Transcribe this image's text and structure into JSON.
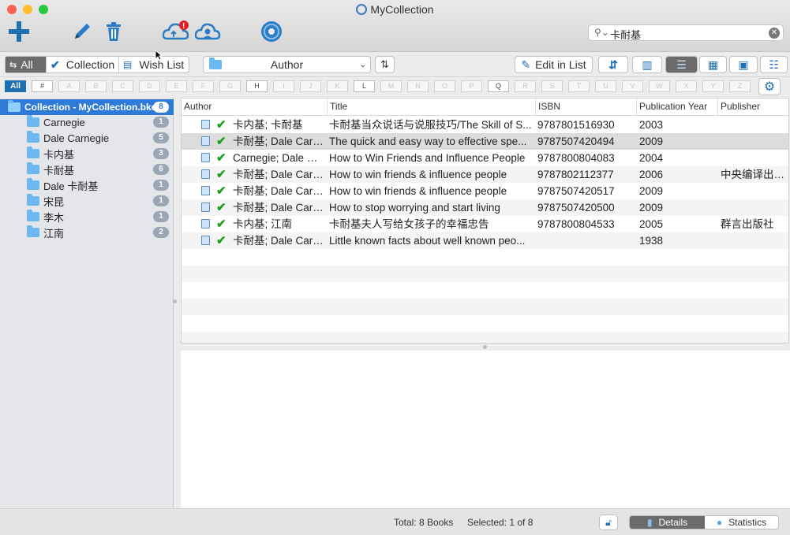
{
  "window": {
    "title": "MyCollection"
  },
  "colors": {
    "accent": "#2f7ad6",
    "check": "#1e9e1e",
    "alert": "#e02020",
    "selected_row": "#dcdcdc"
  },
  "toolbar": {
    "icons": [
      "add-icon",
      "edit-icon",
      "trash-icon",
      "cloud-sync-icon",
      "cloud-user-icon",
      "cd-icon"
    ],
    "sync_badge": "!"
  },
  "search": {
    "value": "卡耐基"
  },
  "filterbar": {
    "all": "All",
    "collection": "Collection",
    "wishlist": "Wish List",
    "group_by": "Author",
    "edit_in_list": "Edit in List"
  },
  "alphabet": [
    "All",
    "#",
    "A",
    "B",
    "C",
    "D",
    "E",
    "F",
    "G",
    "H",
    "I",
    "J",
    "K",
    "L",
    "M",
    "N",
    "O",
    "P",
    "Q",
    "R",
    "S",
    "T",
    "U",
    "V",
    "W",
    "X",
    "Y",
    "Z"
  ],
  "alphabet_active": [
    "All",
    "#",
    "H",
    "L",
    "Q"
  ],
  "sidebar": {
    "items": [
      {
        "label": "Collection - MyCollection.bkcp",
        "count": "8",
        "selected": true
      },
      {
        "label": "Carnegie",
        "count": "1"
      },
      {
        "label": "Dale Carnegie",
        "count": "5"
      },
      {
        "label": "卡内基",
        "count": "3"
      },
      {
        "label": "卡耐基",
        "count": "6"
      },
      {
        "label": "Dale 卡耐基",
        "count": "1"
      },
      {
        "label": "宋昆",
        "count": "1"
      },
      {
        "label": "李木",
        "count": "1"
      },
      {
        "label": "江南",
        "count": "2"
      }
    ]
  },
  "table": {
    "columns": [
      "Author",
      "Title",
      "ISBN",
      "Publication Year",
      "Publisher"
    ],
    "rows": [
      {
        "author": "卡内基; 卡耐基",
        "title": "卡耐基当众说话与说服技巧/The Skill of S...",
        "isbn": "9787801516930",
        "year": "2003",
        "publisher": ""
      },
      {
        "author": "卡耐基; Dale Carn...",
        "title": "The quick and easy way to effective spe...",
        "isbn": "9787507420494",
        "year": "2009",
        "publisher": ""
      },
      {
        "author": "Carnegie; Dale 卡...",
        "title": "How to Win Friends and Influence People",
        "isbn": "9787800804083",
        "year": "2004",
        "publisher": ""
      },
      {
        "author": "卡耐基; Dale Carn...",
        "title": "How to win friends & influence people",
        "isbn": "9787802112377",
        "year": "2006",
        "publisher": "中央编译出版社"
      },
      {
        "author": "卡耐基; Dale Carn...",
        "title": "How to win friends & influence people",
        "isbn": "9787507420517",
        "year": "2009",
        "publisher": ""
      },
      {
        "author": "卡耐基; Dale Carn...",
        "title": "How to stop worrying and start living",
        "isbn": "9787507420500",
        "year": "2009",
        "publisher": ""
      },
      {
        "author": "卡内基; 江南",
        "title": "卡耐基夫人写给女孩子的幸福忠告",
        "isbn": "9787800804533",
        "year": "2005",
        "publisher": "群言出版社"
      },
      {
        "author": "卡耐基; Dale Carn...",
        "title": "Little known facts about well known peo...",
        "isbn": "",
        "year": "1938",
        "publisher": ""
      }
    ],
    "selected_index": 1
  },
  "status": {
    "total": "Total: 8 Books",
    "selected": "Selected: 1 of 8",
    "tab_details": "Details",
    "tab_statistics": "Statistics"
  }
}
